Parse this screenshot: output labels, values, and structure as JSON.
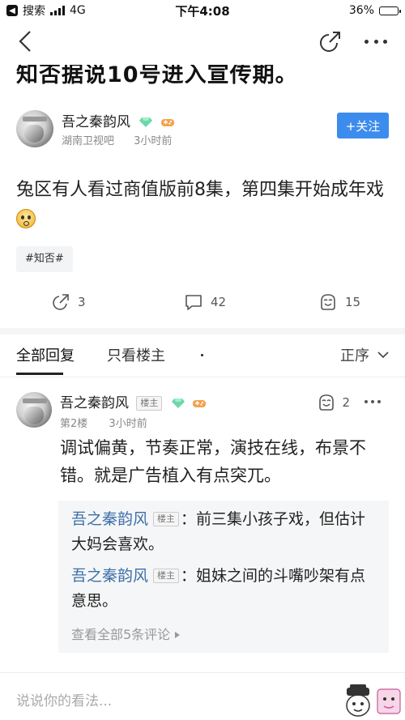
{
  "status_bar": {
    "back_app": "搜索",
    "network": "4G",
    "time": "下午4:08",
    "battery": "36%",
    "battery_level": 0.36
  },
  "post": {
    "title": "知否据说10号进入宣传期。",
    "author": {
      "name": "吾之秦韵风",
      "source": "湖南卫视吧",
      "time": "3小时前"
    },
    "follow_label": "+关注",
    "content": "兔区有人看过商值版前8集，第四集开始成年戏",
    "tag": "#知否#",
    "stats": {
      "shares": "3",
      "comments": "42",
      "likes": "15"
    }
  },
  "tabs": {
    "all": "全部回复",
    "owner_only": "只看楼主",
    "sort": "正序"
  },
  "comment": {
    "author": "吾之秦韵风",
    "owner_badge": "楼主",
    "floor": "第2楼",
    "time": "3小时前",
    "likes": "2",
    "text": "调试偏黄，节奏正常，演技在线，布景不错。就是广告植入有点突兀。",
    "replies": [
      {
        "name": "吾之秦韵风",
        "badge": "楼主",
        "text": "：前三集小孩子戏，但估计大妈会喜欢。"
      },
      {
        "name": "吾之秦韵风",
        "badge": "楼主",
        "text": "：姐妹之间的斗嘴吵架有点意思。"
      }
    ],
    "view_all": "查看全部5条评论"
  },
  "bottom_bar": {
    "placeholder": "说说你的看法..."
  },
  "colors": {
    "accent": "#3c8ced",
    "reply_name": "#3c6fa8"
  }
}
